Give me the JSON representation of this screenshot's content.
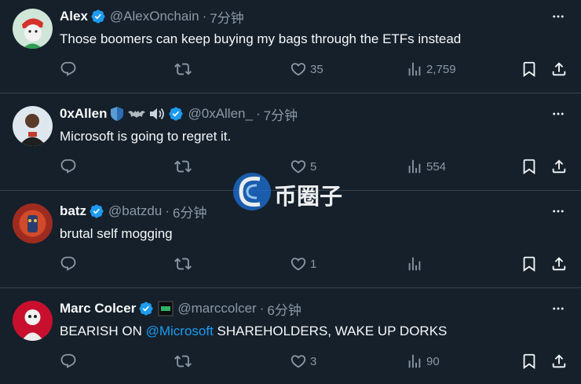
{
  "tweets": [
    {
      "name": "Alex",
      "handle": "@AlexOnchain",
      "time": "7分钟",
      "text": "Those boomers can keep buying my bags through the ETFs instead",
      "likes": "35",
      "views": "2,759"
    },
    {
      "name": "0xAllen",
      "handle": "@0xAllen_",
      "time": "7分钟",
      "text": "Microsoft is going to regret it.",
      "likes": "5",
      "views": "554"
    },
    {
      "name": "batz",
      "handle": "@batzdu",
      "time": "6分钟",
      "text": "brutal self mogging",
      "likes": "1",
      "views": ""
    },
    {
      "name": "Marc Colcer",
      "handle": "@marccolcer",
      "time": "6分钟",
      "text_before": "BEARISH ON ",
      "mention": "@Microsoft",
      "text_after": " SHAREHOLDERS, WAKE UP DORKS",
      "likes": "3",
      "views": "90"
    }
  ],
  "watermark": {
    "text": "币圈子"
  },
  "colors": {
    "background": "#15202b",
    "accent": "#1d9bf0",
    "muted": "#8b98a5",
    "divider": "#38444d"
  },
  "icons": [
    "reply-icon",
    "retweet-icon",
    "like-icon",
    "views-icon",
    "bookmark-icon",
    "share-icon",
    "more-icon",
    "verified-badge-icon"
  ]
}
